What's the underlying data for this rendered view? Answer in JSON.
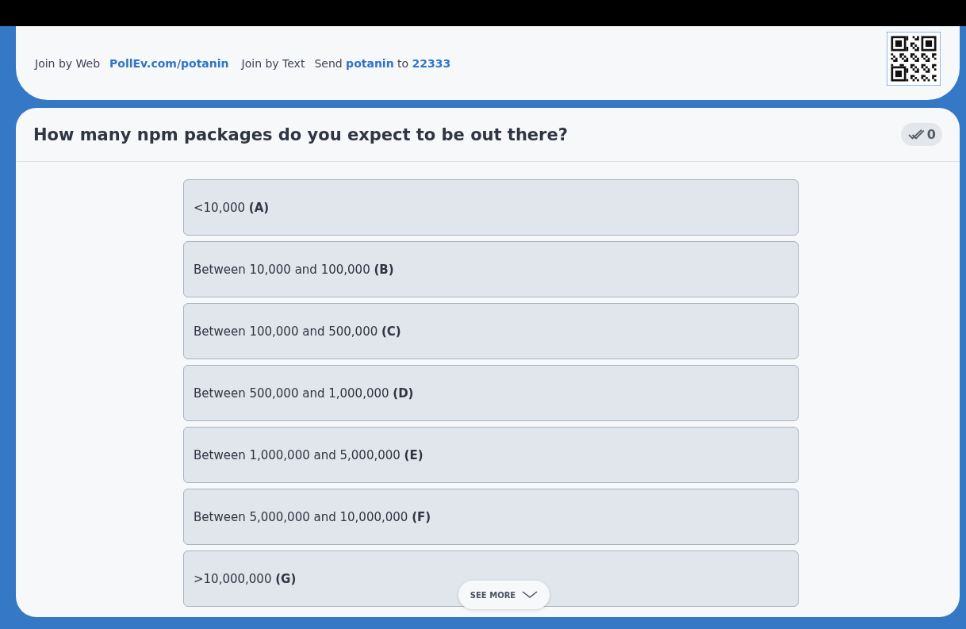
{
  "join_bar": {
    "web_label": "Join by Web",
    "web_link": "PollEv.com/potanin",
    "text_label": "Join by Text",
    "send_word": "Send",
    "keyword": "potanin",
    "to_word": "to",
    "number": "22333"
  },
  "question": {
    "title": "How many npm packages do you expect to be out there?",
    "response_count": "0"
  },
  "options": [
    {
      "label": "<10,000 **(A)**"
    },
    {
      "label": "Between 10,000 and 100,000 **(B)**"
    },
    {
      "label": "Between 100,000 and 500,000 **(C)**"
    },
    {
      "label": "Between 500,000 and 1,000,000 **(D)**"
    },
    {
      "label": "Between 1,000,000 and 5,000,000 **(E)**"
    },
    {
      "label": "Between 5,000,000 and 10,000,000 **(F)**"
    },
    {
      "label": ">10,000,000 **(G)**"
    }
  ],
  "see_more": "SEE MORE"
}
